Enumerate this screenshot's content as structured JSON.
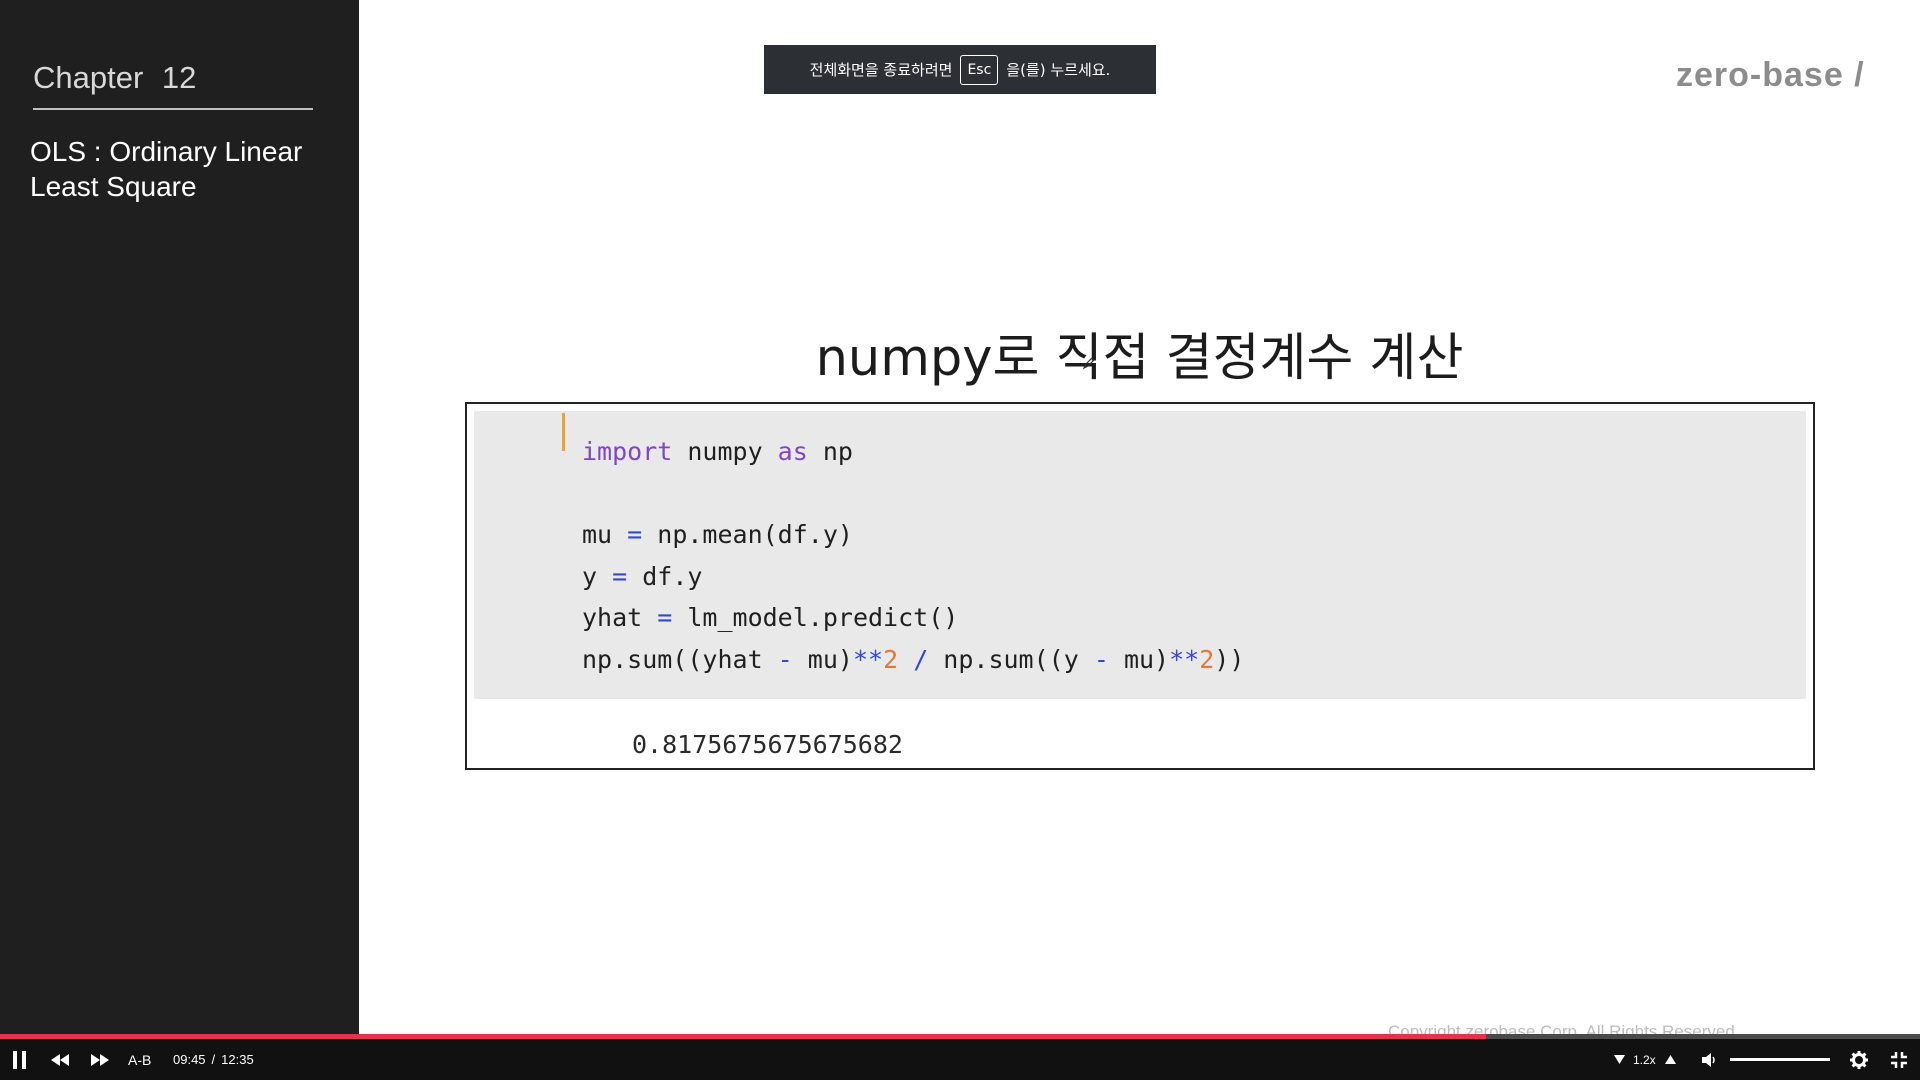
{
  "sidebar": {
    "chapter": "Chapter 12",
    "section_title": "OLS : Ordinary Linear Least Square"
  },
  "fullscreen_notice": {
    "before": "전체화면을 종료하려면",
    "key": "Esc",
    "after": "을(를) 누르세요."
  },
  "logo": "zero-base /",
  "slide": {
    "title": "numpy로 직접 결정계수 계산",
    "code_lines": [
      "import numpy as np",
      "",
      "mu = np.mean(df.y)",
      "y = df.y",
      "yhat = lm_model.predict()",
      "np.sum((yhat - mu)**2 / np.sum((y - mu)**2))"
    ],
    "output": "0.8175675675675682",
    "copyright": "Copyright zerobase Corp. All Rights Reserved"
  },
  "player": {
    "progress_fraction": 0.774,
    "ab_label": "A-B",
    "current_time": "09:45",
    "separator": "/",
    "total_time": "12:35",
    "speed": "1.2x",
    "volume_fraction": 1.0,
    "icons": {
      "play_pause": "pause-icon",
      "rewind": "rewind-icon",
      "forward": "fast-forward-icon",
      "speed_down": "triangle-down-icon",
      "speed_up": "triangle-up-icon",
      "volume": "speaker-icon",
      "settings": "gear-icon",
      "exit_fullscreen": "exit-fullscreen-icon"
    },
    "accent_color": "#e8324a"
  }
}
